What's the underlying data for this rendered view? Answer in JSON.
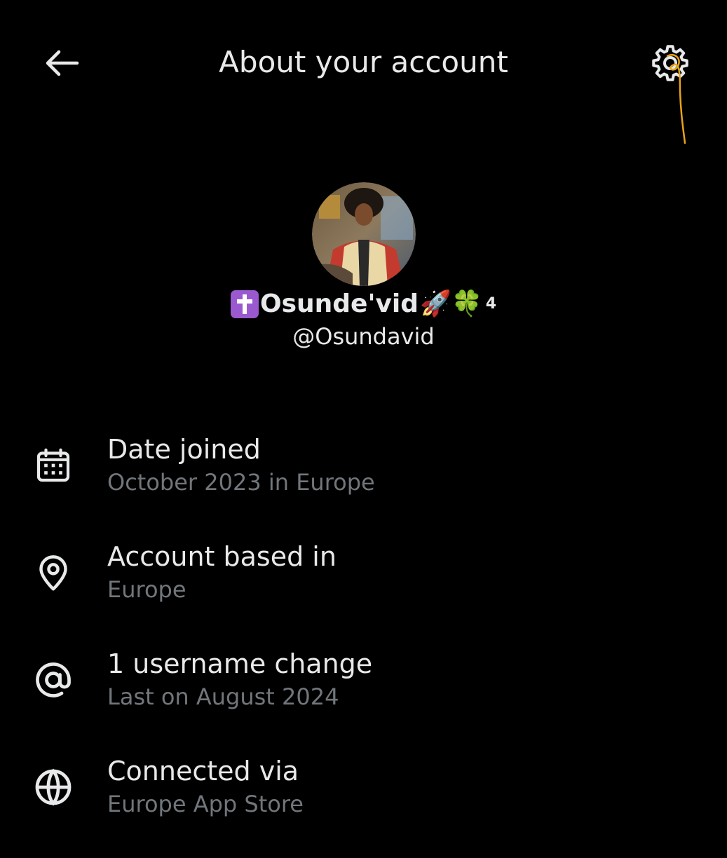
{
  "header": {
    "title": "About your account",
    "back_icon": "arrow-left-icon",
    "settings_icon": "gear-icon"
  },
  "profile": {
    "display_name_text": "Osunde'vid",
    "display_name_prefix_emoji": "latin-cross-emoji",
    "display_name_suffix_emojis": "🚀🍀",
    "display_name_superscript": "4",
    "handle": "@Osundavid"
  },
  "info": [
    {
      "icon": "calendar-icon",
      "title": "Date joined",
      "subtitle": "October 2023 in Europe"
    },
    {
      "icon": "location-pin-icon",
      "title": "Account based in",
      "subtitle": "Europe"
    },
    {
      "icon": "at-sign-icon",
      "title": "1 username change",
      "subtitle": "Last on August 2024"
    },
    {
      "icon": "globe-icon",
      "title": "Connected via",
      "subtitle": "Europe App Store"
    }
  ],
  "colors": {
    "background": "#000000",
    "primary_text": "#e7e9ea",
    "secondary_text": "#71767b",
    "annotation": "#e8a317"
  }
}
